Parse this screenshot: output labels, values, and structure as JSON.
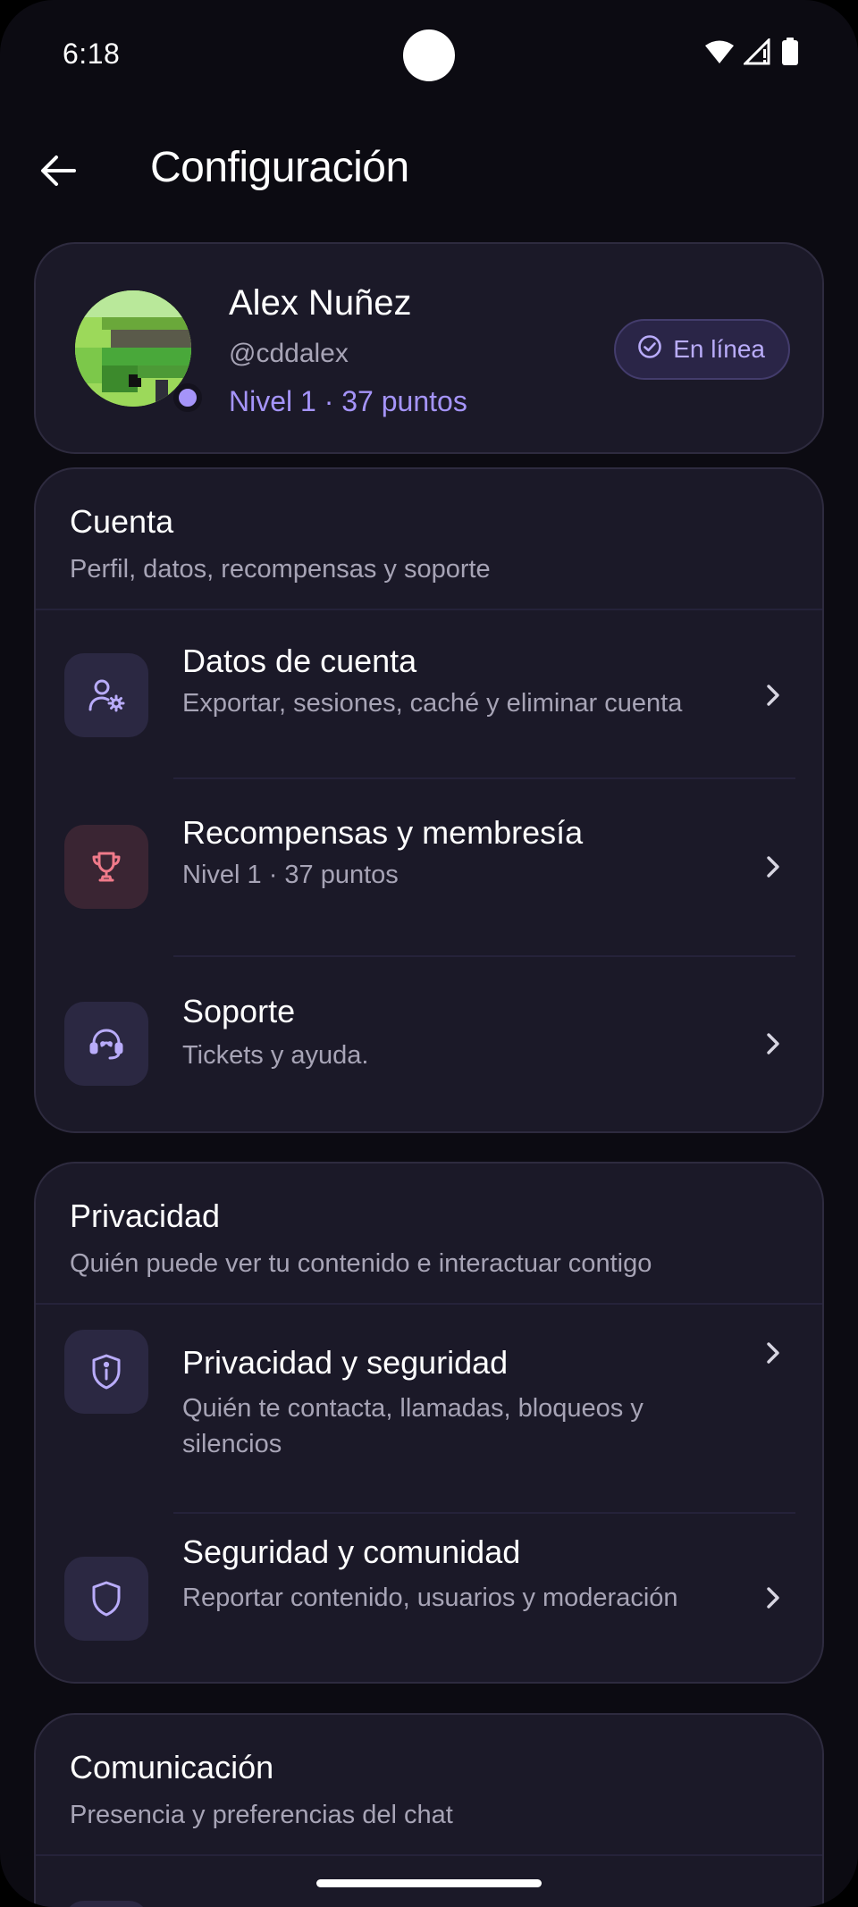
{
  "status_bar": {
    "time": "6:18"
  },
  "app_bar": {
    "title": "Configuración"
  },
  "profile": {
    "name": "Alex Nuñez",
    "handle": "@cddalex",
    "level": "Nivel 1 · 37 puntos",
    "status_badge": "En línea",
    "accent_color": "#a594f9"
  },
  "sections": [
    {
      "title": "Cuenta",
      "subtitle": "Perfil, datos, recompensas y soporte",
      "items": [
        {
          "title": "Datos de cuenta",
          "subtitle": "Exportar, sesiones, caché y eliminar cuenta",
          "icon": "user-settings-icon"
        },
        {
          "title": "Recompensas y membresía",
          "subtitle": "Nivel 1 · 37 puntos",
          "icon": "trophy-icon"
        },
        {
          "title": "Soporte",
          "subtitle": "Tickets y ayuda.",
          "icon": "headset-icon"
        }
      ]
    },
    {
      "title": "Privacidad",
      "subtitle": "Quién puede ver tu contenido e interactuar contigo",
      "items": [
        {
          "title": "Privacidad y seguridad",
          "subtitle": "Quién te contacta, llamadas, bloqueos y silencios",
          "icon": "shield-info-icon"
        },
        {
          "title": "Seguridad y comunidad",
          "subtitle": "Reportar contenido, usuarios y moderación",
          "icon": "shield-icon"
        }
      ]
    },
    {
      "title": "Comunicación",
      "subtitle": "Presencia y preferencias del chat",
      "items": []
    }
  ]
}
